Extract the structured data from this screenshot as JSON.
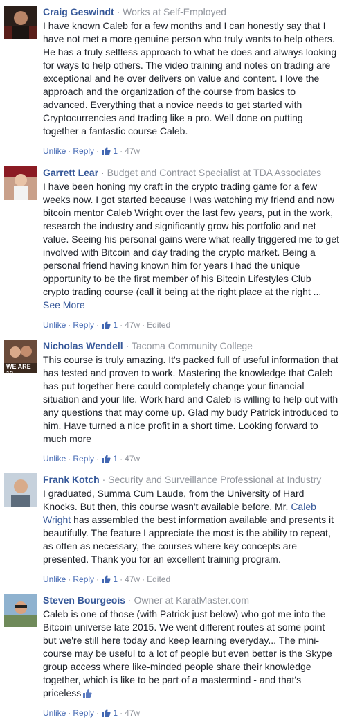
{
  "comments": [
    {
      "author": "Craig Geswindt",
      "subtitle": "Works at Self-Employed",
      "text": "I have known Caleb for a few months and I can honestly say that I have not met a more genuine person who truly wants to help others. He has a truly selfless approach to what he does and always looking for ways to help others. The video training and notes on trading are exceptional and he over delivers on value and content. I love the approach and the organization of the course from basics to advanced. Everything that a novice needs to get started with Cryptocurrencies and trading like a pro. Well done on putting together a fantastic course Caleb.",
      "unlike": "Unlike",
      "reply": "Reply",
      "likes": "1",
      "time": "47w"
    },
    {
      "author": "Garrett Lear",
      "subtitle": "Budget and Contract Specialist at TDA Associates",
      "text": "I have been honing my craft in the crypto trading game for a few weeks now. I got started because I was watching my friend and now bitcoin mentor Caleb Wright over the last few years, put in the work, research the industry and significantly grow his portfolio and net value. Seeing his personal gains were what really triggered me to get involved with Bitcoin and day trading the crypto market. Being a personal friend having known him for years I had the unique opportunity to be the first member of his Bitcoin Lifestyles Club crypto trading course (call it being at the right place at the right ...",
      "see_more": "See More",
      "unlike": "Unlike",
      "reply": "Reply",
      "likes": "1",
      "time": "47w",
      "edited": "Edited"
    },
    {
      "author": "Nicholas Wendell",
      "subtitle": "Tacoma Community College",
      "avatar_text": "WE ARE 12",
      "text": "This course is truly amazing. It's packed full of useful information that has tested and proven to work. Mastering the knowledge that Caleb has put together here could completely change your financial situation and your life. Work hard and Caleb is willing to help out with any questions that may come up. Glad my budy Patrick introduced to him. Have turned a nice profit in a short time. Looking forward to much more",
      "unlike": "Unlike",
      "reply": "Reply",
      "likes": "1",
      "time": "47w"
    },
    {
      "author": "Frank Kotch",
      "subtitle": "Security and Surveillance Professional at Industry",
      "text_before": "I graduated, Summa Cum Laude, from the University of Hard Knocks. But then, this course wasn't available before. Mr. ",
      "mention": "Caleb Wright",
      "text_after": " has assembled the best information available and presents it beautifully. The feature I appreciate the most is the ability to repeat, as often as necessary, the courses where key concepts are presented. Thank you for an excellent training program.",
      "unlike": "Unlike",
      "reply": "Reply",
      "likes": "1",
      "time": "47w",
      "edited": "Edited"
    },
    {
      "author": "Steven Bourgeois",
      "subtitle": "Owner at KaratMaster.com",
      "text": "Caleb is one of those (with Patrick just below) who got me into the Bitcoin universe late 2015. We went different routes at some point but we're still here today and keep learning everyday... The mini-course may be useful to a lot of people but even better is the Skype group access where like-minded people share their knowledge together, which is like to be part of a mastermind - and that's priceless",
      "unlike": "Unlike",
      "reply": "Reply",
      "likes": "1",
      "time": "47w"
    }
  ],
  "separators": {
    "dot": "·"
  },
  "icons": {
    "like": "thumbs-up-icon"
  },
  "colors": {
    "link": "#365899",
    "action": "#4267b2",
    "meta": "#90949c",
    "text": "#1d2129"
  }
}
